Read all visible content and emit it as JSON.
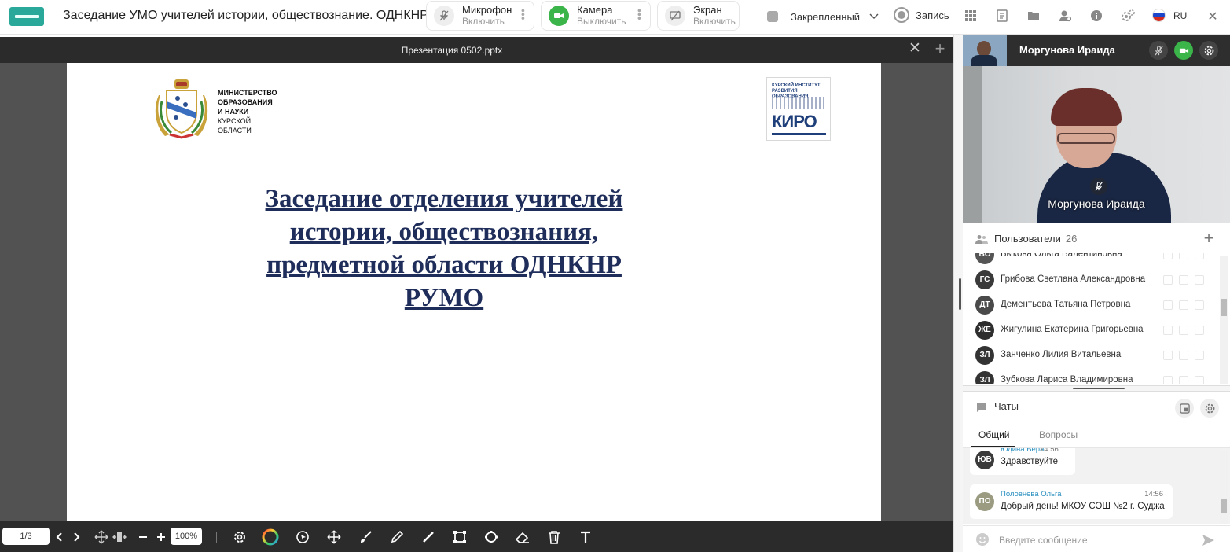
{
  "app": {
    "title": "Заседание УМО учителей истории, обществознание. ОДНКНР"
  },
  "controls": {
    "mic": {
      "label": "Микрофон",
      "action": "Включить"
    },
    "camera": {
      "label": "Камера",
      "action": "Выключить"
    },
    "screen": {
      "label": "Экран",
      "action": "Включить"
    },
    "layout": "Закрепленный",
    "record": "Запись",
    "language": "RU"
  },
  "presentation": {
    "file": "Презентация 0502.pptx",
    "ministry": {
      "bold": [
        "МИНИСТЕРСТВО",
        "ОБРАЗОВАНИЯ",
        "И НАУКИ"
      ],
      "normal": [
        "КУРСКОЙ",
        "ОБЛАСТИ"
      ]
    },
    "kiro": {
      "top": "КУРСКИЙ ИНСТИТУТ РАЗВИТИЯ ОБРАЗОВАНИЯ",
      "main": "КИРО"
    },
    "title_lines": [
      "Заседание отделения  учителей",
      "истории, обществознания,",
      "предметной области ОДНКНР",
      "РУМО"
    ]
  },
  "toolbar": {
    "page": "1/3",
    "zoom": "100%"
  },
  "video": {
    "name": "Моргунова Ираида"
  },
  "users": {
    "title": "Пользователи",
    "count": "26",
    "list": [
      {
        "initials": "БО",
        "name": "Быкова Ольга Валентиновна",
        "color": "#555555"
      },
      {
        "initials": "ГС",
        "name": "Грибова Светлана Александровна",
        "color": "#3a3a3a"
      },
      {
        "initials": "ДТ",
        "name": "Дементьева Татьяна Петровна",
        "color": "#4a4a4a"
      },
      {
        "initials": "ЖЕ",
        "name": "Жигулина Екатерина Григорьевна",
        "color": "#2e2e2e"
      },
      {
        "initials": "ЗЛ",
        "name": "Занченко Лилия Витальевна",
        "color": "#333333"
      },
      {
        "initials": "ЗЛ",
        "name": "Зубкова Лариса Владимировна",
        "color": "#333333"
      }
    ]
  },
  "chats": {
    "title": "Чаты",
    "tabs": [
      "Общий",
      "Вопросы"
    ],
    "messages": [
      {
        "initials": "ЮВ",
        "author": "Юдина Вера",
        "time": "14:56",
        "text": "Здравствуйте",
        "color": "#3b3b3b"
      },
      {
        "initials": "ПО",
        "author": "Половнева Ольга",
        "time": "14:56",
        "text": "Добрый день! МКОУ СОШ №2 г. Суджа",
        "color": "#9b9b82"
      }
    ],
    "input_placeholder": "Введите сообщение"
  }
}
